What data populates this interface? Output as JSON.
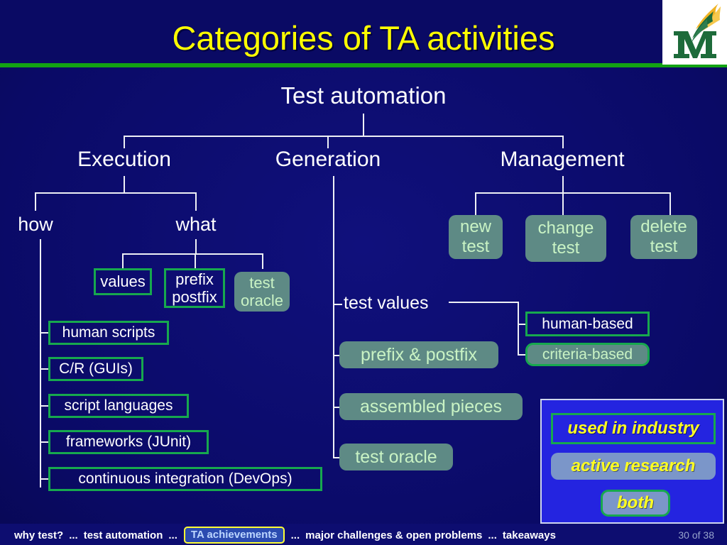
{
  "slide": {
    "title": "Categories of TA activities",
    "logo_alt": "mason-m-logo"
  },
  "tree": {
    "root": "Test automation",
    "level1": {
      "execution": "Execution",
      "generation": "Generation",
      "management": "Management"
    },
    "execution": {
      "how": "how",
      "what": "what",
      "what_children": [
        {
          "label": "values",
          "style": "outline"
        },
        {
          "label": "prefix\npostfix",
          "line1": "prefix",
          "line2": "postfix",
          "style": "outline"
        },
        {
          "label": "test\noracle",
          "line1": "test",
          "line2": "oracle",
          "style": "fill"
        }
      ],
      "how_children": [
        {
          "label": "human scripts",
          "style": "outline"
        },
        {
          "label": "C/R (GUIs)",
          "style": "outline"
        },
        {
          "label": "script languages",
          "style": "outline"
        },
        {
          "label": "frameworks (JUnit)",
          "style": "outline"
        },
        {
          "label": "continuous integration (DevOps)",
          "style": "outline"
        }
      ]
    },
    "generation": {
      "children": [
        {
          "label": "test values",
          "style": "plain"
        },
        {
          "label": "prefix & postfix",
          "style": "fill"
        },
        {
          "label": "assembled pieces",
          "style": "fill"
        },
        {
          "label": "test oracle",
          "style": "fill"
        }
      ],
      "test_values_children": [
        {
          "label": "human-based",
          "style": "outline"
        },
        {
          "label": "criteria-based",
          "style": "fill-bordered"
        }
      ]
    },
    "management": {
      "children": [
        {
          "line1": "new",
          "line2": "test",
          "style": "fill"
        },
        {
          "line1": "change",
          "line2": "test",
          "style": "fill"
        },
        {
          "line1": "delete",
          "line2": "test",
          "style": "fill"
        }
      ]
    }
  },
  "legend": {
    "items": [
      {
        "label": "used in industry",
        "style": "outline"
      },
      {
        "label": "active research",
        "style": "fill"
      },
      {
        "label": "both",
        "style": "fill-bordered"
      }
    ]
  },
  "footer": {
    "items": [
      {
        "label": "why test?",
        "current": false
      },
      {
        "label": "test automation",
        "current": false
      },
      {
        "label": "TA achievements",
        "current": true
      },
      {
        "label": "major challenges & open problems",
        "current": false
      },
      {
        "label": "takeaways",
        "current": false
      }
    ],
    "separator": "...",
    "page_number": "30 of 38"
  },
  "colors": {
    "background": "#0b0b6e",
    "title_text": "#ffff00",
    "title_rule": "#13a313",
    "box_border": "#17a84e",
    "box_fill": "#5e8a85",
    "box_fill_text": "#c9f3c4",
    "connector": "#eef0f5",
    "legend_background": "#2424e0",
    "legend_text": "#ffff22",
    "legend_fill": "#7b96c9",
    "footer_current_border": "#ffff33",
    "footer_current_text": "#bcd6ff"
  }
}
